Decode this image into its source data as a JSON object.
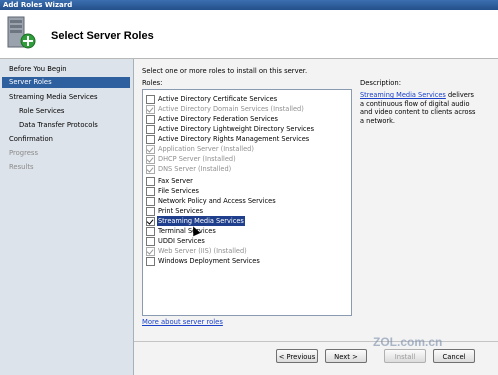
{
  "window": {
    "title": "Add Roles Wizard"
  },
  "banner": {
    "title": "Select Server Roles",
    "icon": "server-add-icon"
  },
  "nav": {
    "items": [
      {
        "label": "Before You Begin",
        "state": "normal"
      },
      {
        "label": "Server Roles",
        "state": "selected"
      },
      {
        "label": "Streaming Media Services",
        "state": "normal"
      },
      {
        "label": "Role Services",
        "state": "sub"
      },
      {
        "label": "Data Transfer Protocols",
        "state": "sub"
      },
      {
        "label": "Confirmation",
        "state": "normal"
      },
      {
        "label": "Progress",
        "state": "disabled"
      },
      {
        "label": "Results",
        "state": "disabled"
      }
    ]
  },
  "main": {
    "instruction": "Select one or more roles to install on this server.",
    "roles_label": "Roles:",
    "roles": [
      {
        "label": "Active Directory Certificate Services",
        "checked": false,
        "disabled": false
      },
      {
        "label": "Active Directory Domain Services  (Installed)",
        "checked": true,
        "disabled": true
      },
      {
        "label": "Active Directory Federation Services",
        "checked": false,
        "disabled": false
      },
      {
        "label": "Active Directory Lightweight Directory Services",
        "checked": false,
        "disabled": false
      },
      {
        "label": "Active Directory Rights Management Services",
        "checked": false,
        "disabled": false
      },
      {
        "label": "Application Server  (Installed)",
        "checked": true,
        "disabled": true
      },
      {
        "label": "DHCP Server  (Installed)",
        "checked": true,
        "disabled": true
      },
      {
        "label": "DNS Server  (Installed)",
        "checked": true,
        "disabled": true
      },
      {
        "label": "Fax Server",
        "checked": false,
        "disabled": false
      },
      {
        "label": "File Services",
        "checked": false,
        "disabled": false
      },
      {
        "label": "Network Policy and Access Services",
        "checked": false,
        "disabled": false
      },
      {
        "label": "Print Services",
        "checked": false,
        "disabled": false
      },
      {
        "label": "Streaming Media Services",
        "checked": true,
        "disabled": false,
        "selected": true
      },
      {
        "label": "Terminal Services",
        "checked": false,
        "disabled": false
      },
      {
        "label": "UDDI Services",
        "checked": false,
        "disabled": false
      },
      {
        "label": "Web Server (IIS)  (Installed)",
        "checked": true,
        "disabled": true
      },
      {
        "label": "Windows Deployment Services",
        "checked": false,
        "disabled": false
      }
    ],
    "more_link": "More about server roles",
    "description_label": "Description:",
    "description_link": "Streaming Media Services",
    "description_text": " delivers a continuous flow of digital audio and video content to clients across a network."
  },
  "buttons": {
    "previous": "< Previous",
    "next": "Next >",
    "install": "Install",
    "cancel": "Cancel"
  },
  "watermark": {
    "text": "ZOL.com.cn"
  }
}
